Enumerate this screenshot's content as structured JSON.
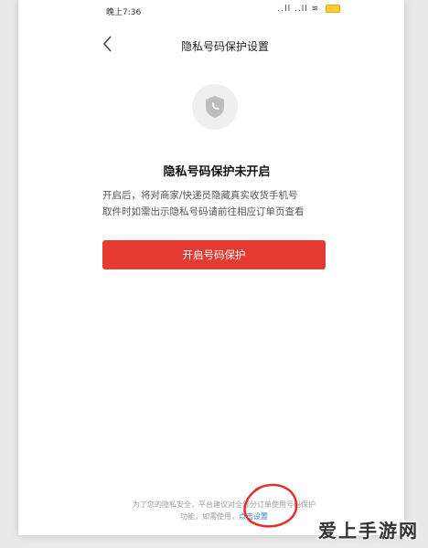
{
  "status_bar": {
    "time": "晚上7:36",
    "right_icons": "..ll ..ll ≋"
  },
  "navbar": {
    "title": "隐私号码保护设置"
  },
  "main": {
    "heading": "隐私号码保护未开启",
    "description_line1": "开启后，将对商家/快递员隐藏真实收货手机号",
    "description_line2": "取件时如需出示隐私号码请前往相应订单页查看",
    "button_label": "开启号码保护"
  },
  "footer": {
    "line1": "为了您的隐私安全，平台建议对全部分订单使用号码保护",
    "line2_prefix": "功能，如需使用，",
    "link_label": "点击设置"
  },
  "watermark": "爱上手游网",
  "colors": {
    "primary": "#e53a2f",
    "link": "#3a7bd5",
    "annotation": "#e0322a"
  }
}
